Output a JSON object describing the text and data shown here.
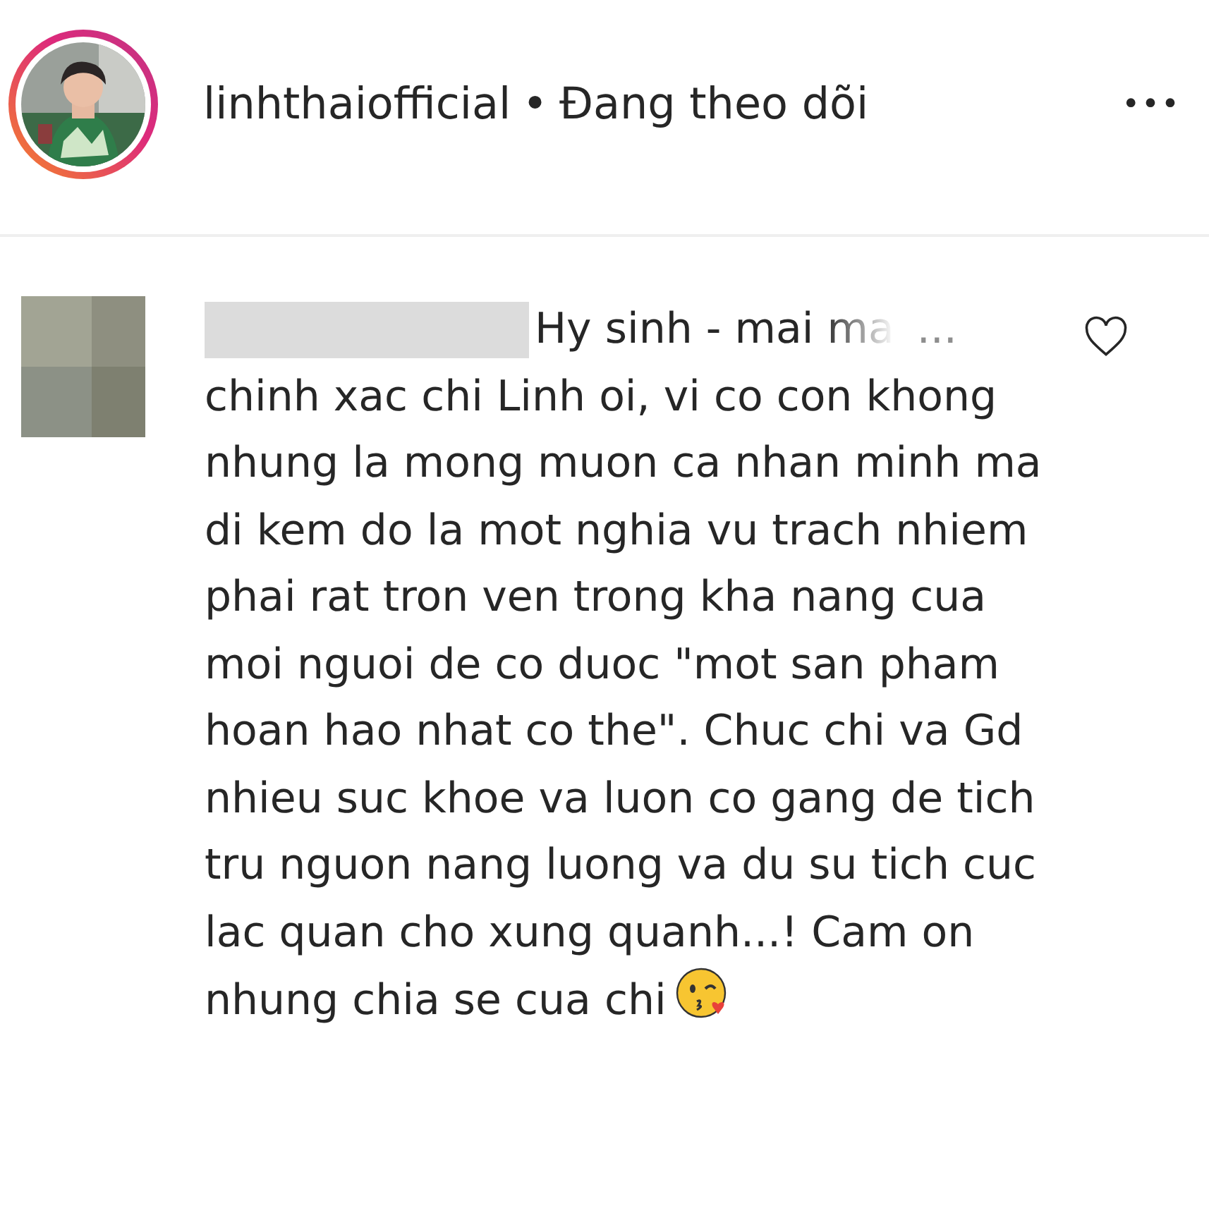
{
  "post_header": {
    "username": "linhthaiofficial",
    "separator": "•",
    "follow_status": "Đang theo dõi",
    "more": "•••"
  },
  "comment": {
    "preview": "Hy sinh - mai ma",
    "more": "...",
    "liked": false,
    "text": "chinh xac chi Linh oi, vi co con khong nhung la mong muon ca nhan minh ma di kem do la mot nghia vu trach nhiem phai rat tron ven trong kha nang cua moi nguoi de co duoc \"mot san pham hoan hao nhat co the\". Chuc chi va Gd nhieu suc khoe va luon co gang de tich tru nguon nang luong va du su tich cuc lac quan cho xung quanh...! Cam on nhung chia se cua chi"
  }
}
